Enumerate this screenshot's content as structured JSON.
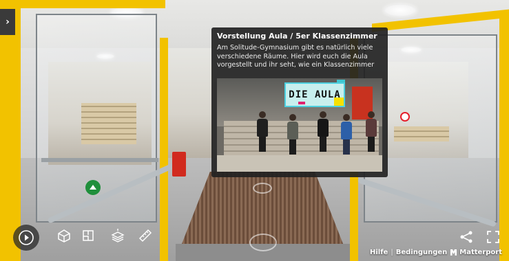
{
  "sidebar_toggle": {
    "glyph": "›"
  },
  "info_card": {
    "title": "Vorstellung Aula / 5er Klassenzimmer",
    "description": "Am Solitude-Gymnasium gibt es natürlich viele verschiedene Räume. Hier wird euch die Aula vorgestellt und ihr seht, wie ein Klassenzimmer",
    "media_sign_text": "DIE AULA"
  },
  "toolbar": {
    "play_icon": "play-icon",
    "items": [
      {
        "icon": "dollhouse-icon"
      },
      {
        "icon": "floorplan-icon"
      },
      {
        "icon": "floor-selector-icon"
      },
      {
        "icon": "measure-icon"
      }
    ]
  },
  "footer": {
    "help_label": "Hilfe",
    "separator": "|",
    "terms_label": "Bedingungen",
    "brand_label": "Matterport"
  },
  "colors": {
    "door_frame": "#f2c200",
    "panel_bg": "#222222",
    "hotspot_ring": "#e51e2a",
    "exit_sign": "#1f8f3b"
  }
}
